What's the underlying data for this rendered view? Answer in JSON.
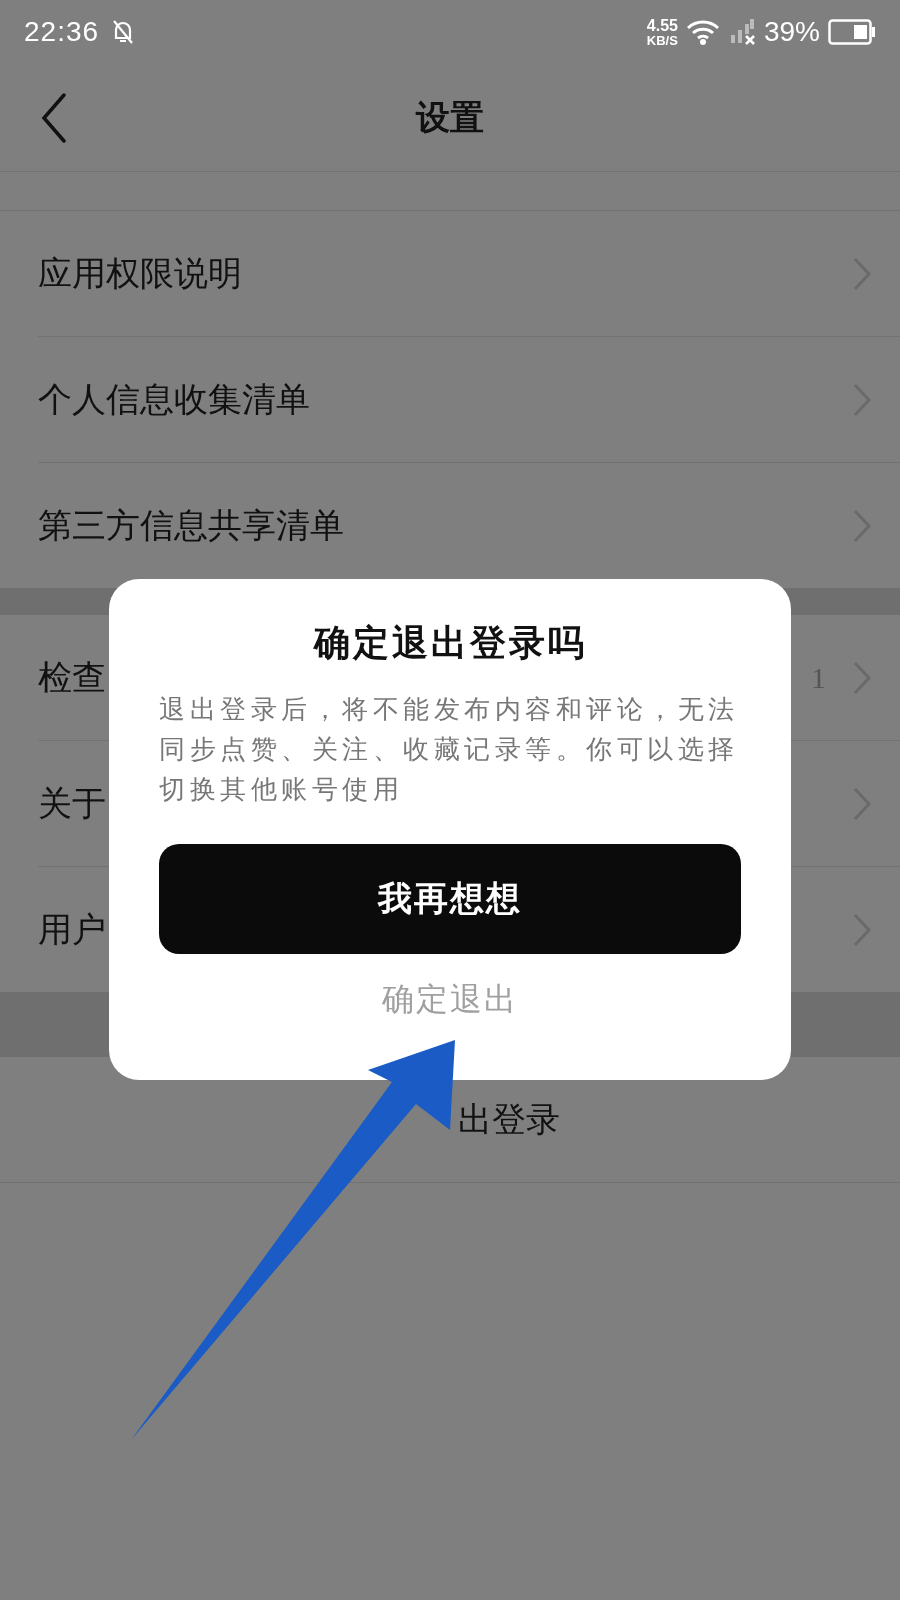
{
  "status_bar": {
    "time": "22:36",
    "speed_value": "4.55",
    "speed_unit": "KB/S",
    "battery": "39%"
  },
  "header": {
    "title": "设置"
  },
  "groups": [
    {
      "items": [
        {
          "label": "应用权限说明"
        },
        {
          "label": "个人信息收集清单"
        },
        {
          "label": "第三方信息共享清单"
        }
      ]
    },
    {
      "items": [
        {
          "label": "检查",
          "value": "1"
        },
        {
          "label": "关于"
        },
        {
          "label": "用户"
        }
      ]
    }
  ],
  "logout": {
    "label": "出登录"
  },
  "dialog": {
    "title": "确定退出登录吗",
    "message": "退出登录后，将不能发布内容和评论，无法同步点赞、关注、收藏记录等。你可以选择切换其他账号使用",
    "buttons": [
      {
        "label": "我再想想",
        "kind": "primary"
      },
      {
        "label": "确定退出",
        "kind": "text"
      }
    ]
  }
}
